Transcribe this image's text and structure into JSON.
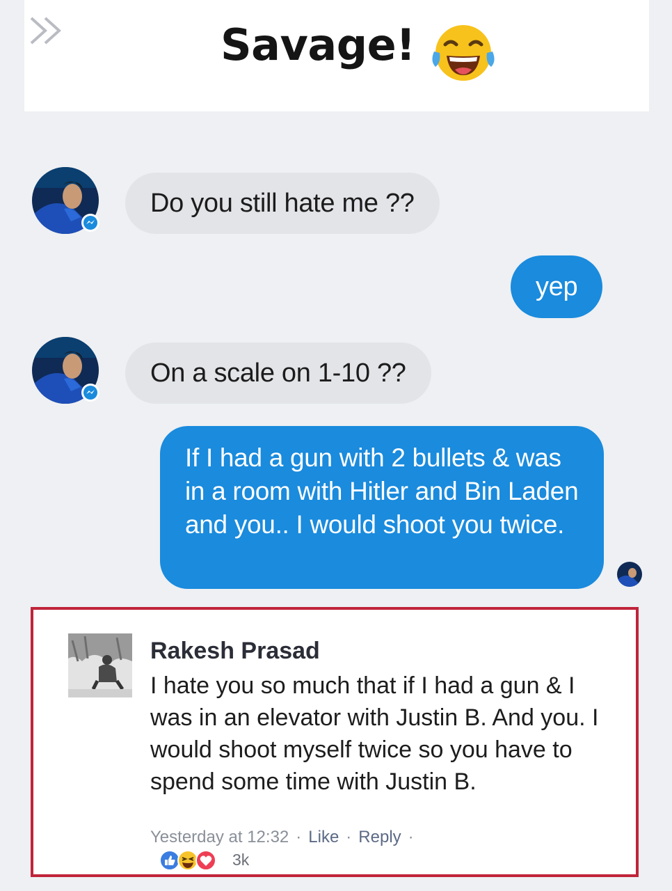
{
  "header": {
    "title": "Savage!",
    "emoji_icon": "tears-of-joy-icon",
    "nav_icon": "double-chevron-right-icon"
  },
  "messages": [
    {
      "from": "other",
      "text": "Do you still hate me ??"
    },
    {
      "from": "me",
      "text": "yep"
    },
    {
      "from": "other",
      "text": "On a scale on 1-10 ??"
    },
    {
      "from": "me",
      "text": "If I had a gun with 2 bullets & was in a room with Hitler and Bin Laden and you.. I would shoot you twice."
    }
  ],
  "comment": {
    "author": "Rakesh Prasad",
    "text": "I hate you so much that if I had a gun & I was in an elevator with Justin B. And you. I would shoot myself twice so you have to spend some time with Justin B.",
    "timestamp": "Yesterday at 12:32",
    "like_label": "Like",
    "reply_label": "Reply",
    "separator": "·",
    "reaction_count": "3k",
    "reactions": [
      "like-icon",
      "haha-icon",
      "love-icon"
    ]
  },
  "colors": {
    "outgoing_bubble": "#1a8bdd",
    "incoming_bubble": "#e3e4e8",
    "highlight_border": "#c0243a"
  }
}
